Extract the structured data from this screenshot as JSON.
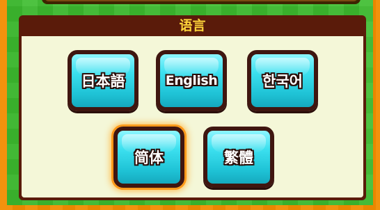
{
  "panel": {
    "title": "语言"
  },
  "languages": [
    {
      "label": "日本語",
      "selected": false
    },
    {
      "label": "English",
      "selected": false
    },
    {
      "label": "한국어",
      "selected": false
    },
    {
      "label": "简体",
      "selected": true
    },
    {
      "label": "繁體",
      "selected": false
    }
  ],
  "colors": {
    "panel_header": "#5a1b0a",
    "title_text": "#ffd53a",
    "panel_body": "#f4f7d8",
    "button_fill": "#3ce0ef",
    "selected_glow": "#ff9a1a",
    "background_green": "#3dbd2f",
    "frame_orange": "#f28c00"
  }
}
